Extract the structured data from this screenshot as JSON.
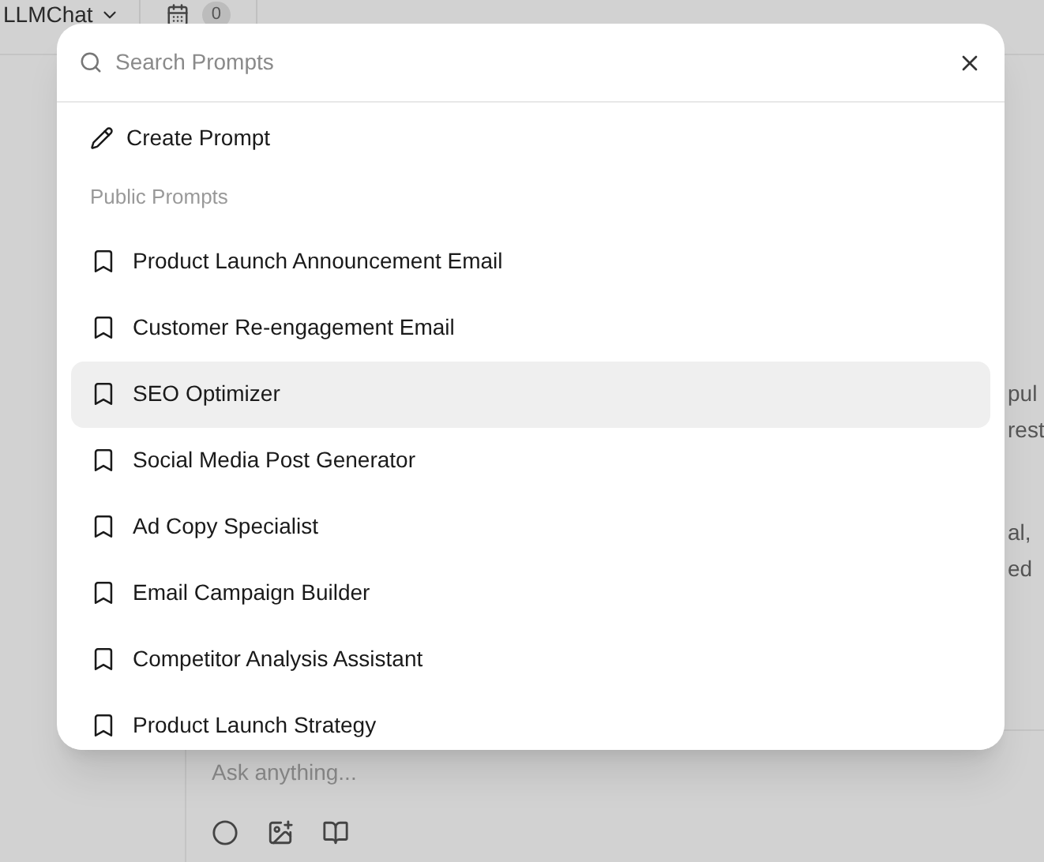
{
  "topbar": {
    "model_selector": "LLMChat",
    "badge": "0"
  },
  "background_text": [
    "pul",
    "rest",
    "al,",
    "ed"
  ],
  "chat_input": {
    "placeholder": "Ask anything..."
  },
  "dialog": {
    "search": {
      "placeholder": "Search Prompts"
    },
    "create": "Create Prompt",
    "section": "Public Prompts",
    "prompts": [
      {
        "label": "Product Launch Announcement Email",
        "selected": false
      },
      {
        "label": "Customer Re-engagement Email",
        "selected": false
      },
      {
        "label": "SEO Optimizer",
        "selected": true
      },
      {
        "label": "Social Media Post Generator",
        "selected": false
      },
      {
        "label": "Ad Copy Specialist",
        "selected": false
      },
      {
        "label": "Email Campaign Builder",
        "selected": false
      },
      {
        "label": "Competitor Analysis Assistant",
        "selected": false
      },
      {
        "label": "Product Launch Strategy",
        "selected": false
      }
    ]
  }
}
